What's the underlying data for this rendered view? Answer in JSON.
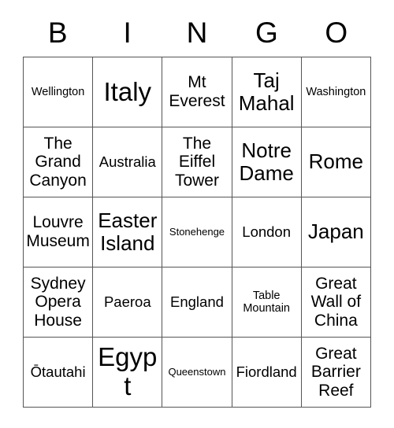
{
  "card": {
    "title": "BINGO",
    "headers": [
      "B",
      "I",
      "N",
      "G",
      "O"
    ],
    "grid_line_color": "#555555",
    "text_color": "#000000",
    "background_color": "#ffffff",
    "rows": [
      [
        {
          "text": "Wellington",
          "size": "sm"
        },
        {
          "text": "Italy",
          "size": "xxl"
        },
        {
          "text": "Mt Everest",
          "size": "lg"
        },
        {
          "text": "Taj Mahal",
          "size": "xl"
        },
        {
          "text": "Washington",
          "size": "sm"
        }
      ],
      [
        {
          "text": "The Grand Canyon",
          "size": "lg"
        },
        {
          "text": "Australia",
          "size": "md"
        },
        {
          "text": "The Eiffel Tower",
          "size": "lg"
        },
        {
          "text": "Notre Dame",
          "size": "xl"
        },
        {
          "text": "Rome",
          "size": "xl"
        }
      ],
      [
        {
          "text": "Louvre Museum",
          "size": "lg"
        },
        {
          "text": "Easter Island",
          "size": "xl"
        },
        {
          "text": "Stonehenge",
          "size": "xs"
        },
        {
          "text": "London",
          "size": "md"
        },
        {
          "text": "Japan",
          "size": "xl"
        }
      ],
      [
        {
          "text": "Sydney Opera House",
          "size": "lg"
        },
        {
          "text": "Paeroa",
          "size": "md"
        },
        {
          "text": "England",
          "size": "md"
        },
        {
          "text": "Table Mountain",
          "size": "sm"
        },
        {
          "text": "Great Wall of China",
          "size": "lg"
        }
      ],
      [
        {
          "text": "Ōtautahi",
          "size": "md"
        },
        {
          "text": "Egypt",
          "size": "xxl"
        },
        {
          "text": "Queenstown",
          "size": "xs"
        },
        {
          "text": "Fiordland",
          "size": "md"
        },
        {
          "text": "Great Barrier Reef",
          "size": "lg"
        }
      ]
    ]
  }
}
